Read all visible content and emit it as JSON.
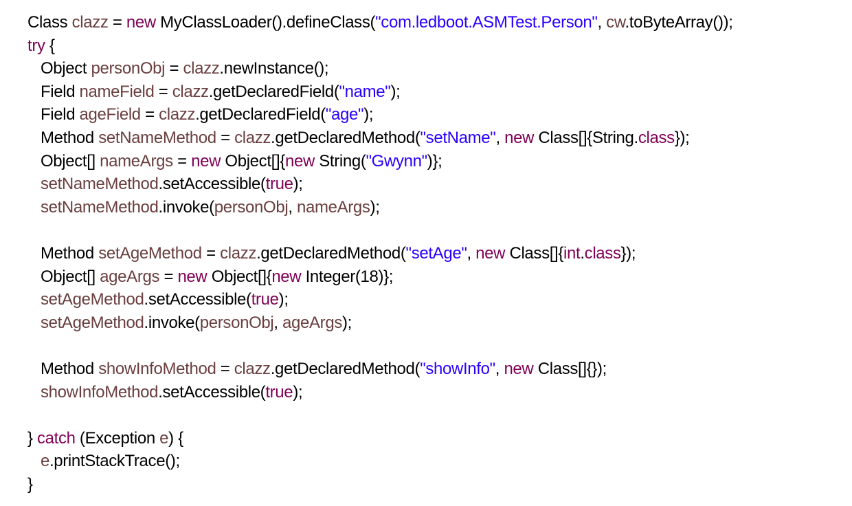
{
  "colors": {
    "plain": "#000000",
    "keyword": "#7f0055",
    "variable": "#6a3e3e",
    "string": "#2a00ff"
  },
  "code": {
    "lines": [
      [
        [
          "plain",
          "Class "
        ],
        [
          "var",
          "clazz"
        ],
        [
          "plain",
          " = "
        ],
        [
          "keyword",
          "new"
        ],
        [
          "plain",
          " MyClassLoader().defineClass("
        ],
        [
          "string",
          "\"com.ledboot.ASMTest.Person\""
        ],
        [
          "plain",
          ", "
        ],
        [
          "var",
          "cw"
        ],
        [
          "plain",
          ".toByteArray());"
        ]
      ],
      [
        [
          "keyword",
          "try"
        ],
        [
          "plain",
          " {"
        ]
      ],
      [
        [
          "plain",
          "   Object "
        ],
        [
          "var",
          "personObj"
        ],
        [
          "plain",
          " = "
        ],
        [
          "var",
          "clazz"
        ],
        [
          "plain",
          ".newInstance();"
        ]
      ],
      [
        [
          "plain",
          "   Field "
        ],
        [
          "var",
          "nameField"
        ],
        [
          "plain",
          " = "
        ],
        [
          "var",
          "clazz"
        ],
        [
          "plain",
          ".getDeclaredField("
        ],
        [
          "string",
          "\"name\""
        ],
        [
          "plain",
          ");"
        ]
      ],
      [
        [
          "plain",
          "   Field "
        ],
        [
          "var",
          "ageField"
        ],
        [
          "plain",
          " = "
        ],
        [
          "var",
          "clazz"
        ],
        [
          "plain",
          ".getDeclaredField("
        ],
        [
          "string",
          "\"age\""
        ],
        [
          "plain",
          ");"
        ]
      ],
      [
        [
          "plain",
          "   Method "
        ],
        [
          "var",
          "setNameMethod"
        ],
        [
          "plain",
          " = "
        ],
        [
          "var",
          "clazz"
        ],
        [
          "plain",
          ".getDeclaredMethod("
        ],
        [
          "string",
          "\"setName\""
        ],
        [
          "plain",
          ", "
        ],
        [
          "keyword",
          "new"
        ],
        [
          "plain",
          " Class[]{String."
        ],
        [
          "keyword",
          "class"
        ],
        [
          "plain",
          "});"
        ]
      ],
      [
        [
          "plain",
          "   Object[] "
        ],
        [
          "var",
          "nameArgs"
        ],
        [
          "plain",
          " = "
        ],
        [
          "keyword",
          "new"
        ],
        [
          "plain",
          " Object[]{"
        ],
        [
          "keyword",
          "new"
        ],
        [
          "plain",
          " String("
        ],
        [
          "string",
          "\"Gwynn\""
        ],
        [
          "plain",
          ")};"
        ]
      ],
      [
        [
          "plain",
          "   "
        ],
        [
          "var",
          "setNameMethod"
        ],
        [
          "plain",
          ".setAccessible("
        ],
        [
          "keyword",
          "true"
        ],
        [
          "plain",
          ");"
        ]
      ],
      [
        [
          "plain",
          "   "
        ],
        [
          "var",
          "setNameMethod"
        ],
        [
          "plain",
          ".invoke("
        ],
        [
          "var",
          "personObj"
        ],
        [
          "plain",
          ", "
        ],
        [
          "var",
          "nameArgs"
        ],
        [
          "plain",
          ");"
        ]
      ],
      [],
      [
        [
          "plain",
          "   Method "
        ],
        [
          "var",
          "setAgeMethod"
        ],
        [
          "plain",
          " = "
        ],
        [
          "var",
          "clazz"
        ],
        [
          "plain",
          ".getDeclaredMethod("
        ],
        [
          "string",
          "\"setAge\""
        ],
        [
          "plain",
          ", "
        ],
        [
          "keyword",
          "new"
        ],
        [
          "plain",
          " Class[]{"
        ],
        [
          "keyword",
          "int"
        ],
        [
          "plain",
          "."
        ],
        [
          "keyword",
          "class"
        ],
        [
          "plain",
          "});"
        ]
      ],
      [
        [
          "plain",
          "   Object[] "
        ],
        [
          "var",
          "ageArgs"
        ],
        [
          "plain",
          " = "
        ],
        [
          "keyword",
          "new"
        ],
        [
          "plain",
          " Object[]{"
        ],
        [
          "keyword",
          "new"
        ],
        [
          "plain",
          " Integer(18)};"
        ]
      ],
      [
        [
          "plain",
          "   "
        ],
        [
          "var",
          "setAgeMethod"
        ],
        [
          "plain",
          ".setAccessible("
        ],
        [
          "keyword",
          "true"
        ],
        [
          "plain",
          ");"
        ]
      ],
      [
        [
          "plain",
          "   "
        ],
        [
          "var",
          "setAgeMethod"
        ],
        [
          "plain",
          ".invoke("
        ],
        [
          "var",
          "personObj"
        ],
        [
          "plain",
          ", "
        ],
        [
          "var",
          "ageArgs"
        ],
        [
          "plain",
          ");"
        ]
      ],
      [],
      [
        [
          "plain",
          "   Method "
        ],
        [
          "var",
          "showInfoMethod"
        ],
        [
          "plain",
          " = "
        ],
        [
          "var",
          "clazz"
        ],
        [
          "plain",
          ".getDeclaredMethod("
        ],
        [
          "string",
          "\"showInfo\""
        ],
        [
          "plain",
          ", "
        ],
        [
          "keyword",
          "new"
        ],
        [
          "plain",
          " Class[]{});"
        ]
      ],
      [
        [
          "plain",
          "   "
        ],
        [
          "var",
          "showInfoMethod"
        ],
        [
          "plain",
          ".setAccessible("
        ],
        [
          "keyword",
          "true"
        ],
        [
          "plain",
          ");"
        ]
      ],
      [],
      [
        [
          "plain",
          "} "
        ],
        [
          "keyword",
          "catch"
        ],
        [
          "plain",
          " (Exception "
        ],
        [
          "var",
          "e"
        ],
        [
          "plain",
          ") {"
        ]
      ],
      [
        [
          "plain",
          "   "
        ],
        [
          "var",
          "e"
        ],
        [
          "plain",
          ".printStackTrace();"
        ]
      ],
      [
        [
          "plain",
          "}"
        ]
      ]
    ]
  }
}
